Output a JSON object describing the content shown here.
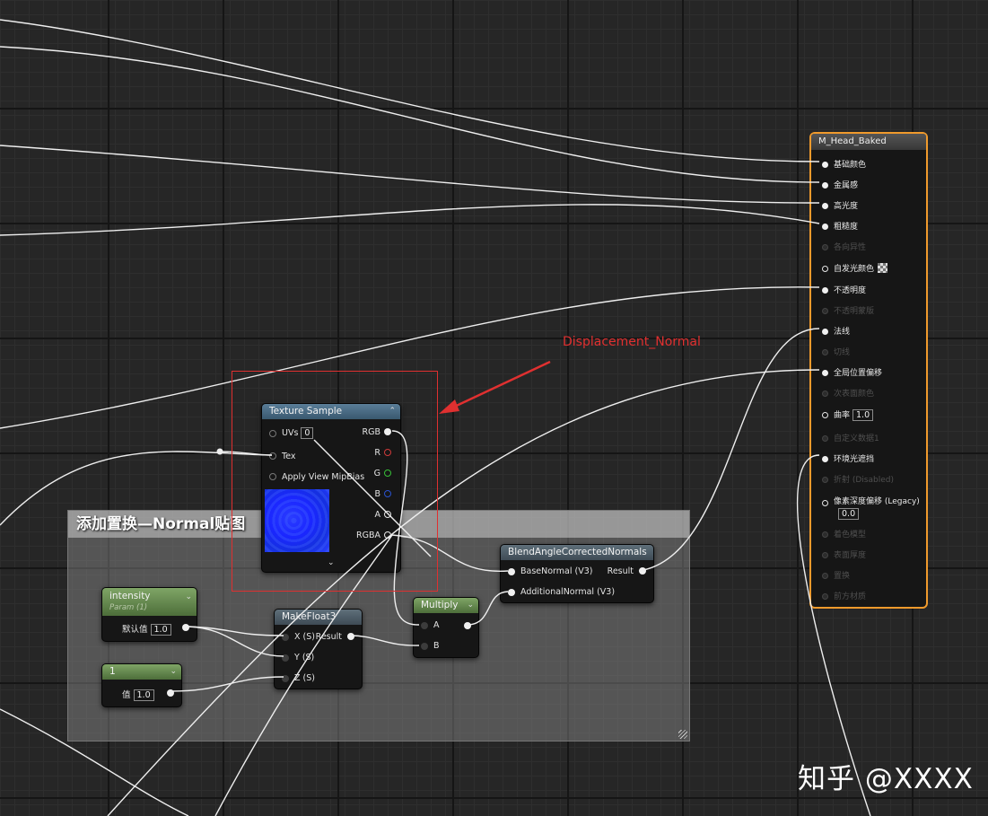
{
  "annotation": {
    "label": "Displacement_Normal"
  },
  "watermark": "知乎 @XXXX",
  "comment_box": {
    "title": "添加置换—Normal贴图"
  },
  "texture_sample": {
    "title": "Texture Sample",
    "inputs": [
      {
        "label": "UVs",
        "value": "0"
      },
      {
        "label": "Tex"
      },
      {
        "label": "Apply View MipBias"
      }
    ],
    "outputs": [
      "RGB",
      "R",
      "G",
      "B",
      "A",
      "RGBA"
    ]
  },
  "intensity_param": {
    "title": "intensity",
    "subtitle": "Param (1)",
    "label": "默认值",
    "value": "1.0"
  },
  "constant_node": {
    "title": "1",
    "label": "值",
    "value": "1.0"
  },
  "make_float3": {
    "title": "MakeFloat3",
    "inputs": [
      "X (S)",
      "Y (S)",
      "Z (S)"
    ],
    "output": "Result"
  },
  "multiply": {
    "title": "Multiply",
    "inputs": [
      "A",
      "B"
    ]
  },
  "blend_normals": {
    "title": "BlendAngleCorrectedNormals",
    "inputs": [
      "BaseNormal (V3)",
      "AdditionalNormal (V3)"
    ],
    "output": "Result"
  },
  "material_result": {
    "title": "M_Head_Baked",
    "pins": [
      {
        "label": "基础颜色",
        "enabled": true
      },
      {
        "label": "金属感",
        "enabled": true
      },
      {
        "label": "高光度",
        "enabled": true
      },
      {
        "label": "粗糙度",
        "enabled": true
      },
      {
        "label": "各向异性",
        "enabled": false
      },
      {
        "label": "自发光颜色",
        "enabled": true
      },
      {
        "label": "不透明度",
        "enabled": true
      },
      {
        "label": "不透明蒙版",
        "enabled": false
      },
      {
        "label": "法线",
        "enabled": true
      },
      {
        "label": "切线",
        "enabled": false
      },
      {
        "label": "全局位置偏移",
        "enabled": true
      },
      {
        "label": "次表面颜色",
        "enabled": false
      },
      {
        "label": "曲率",
        "enabled": true,
        "value": "1.0"
      },
      {
        "label": "自定义数据1",
        "enabled": false
      },
      {
        "label": "环境光遮挡",
        "enabled": true
      },
      {
        "label": "折射 (Disabled)",
        "enabled": false
      },
      {
        "label": "像素深度偏移 (Legacy)",
        "enabled": true,
        "value": "0.0"
      },
      {
        "label": "着色模型",
        "enabled": false
      },
      {
        "label": "表面厚度",
        "enabled": false
      },
      {
        "label": "置换",
        "enabled": false
      },
      {
        "label": "前方材质",
        "enabled": false
      }
    ]
  }
}
